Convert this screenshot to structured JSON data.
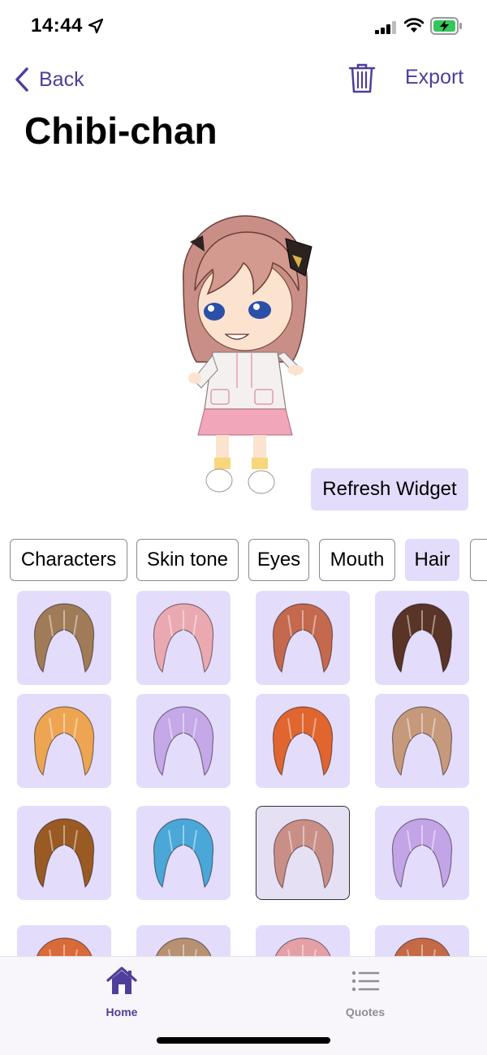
{
  "status_bar": {
    "time": "14:44",
    "icons": [
      "location-arrow-icon",
      "signal-icon",
      "wifi-icon",
      "battery-charging-icon"
    ]
  },
  "nav": {
    "back_label": "Back",
    "export_label": "Export",
    "trash_icon": "trash-icon"
  },
  "page": {
    "title": "Chibi-chan"
  },
  "preview": {
    "refresh_label": "Refresh Widget"
  },
  "tabs": [
    {
      "label": "Characters",
      "active": false
    },
    {
      "label": "Skin tone",
      "active": false
    },
    {
      "label": "Eyes",
      "active": false
    },
    {
      "label": "Mouth",
      "active": false
    },
    {
      "label": "Hair",
      "active": true
    }
  ],
  "hair_grid": {
    "selected_index": 10,
    "items": [
      {
        "name": "hair-1",
        "color": "#a07b58"
      },
      {
        "name": "hair-2",
        "color": "#eaa9b1"
      },
      {
        "name": "hair-3",
        "color": "#c4694d"
      },
      {
        "name": "hair-4",
        "color": "#5a3426"
      },
      {
        "name": "hair-5",
        "color": "#eda552"
      },
      {
        "name": "hair-6",
        "color": "#c4a8e8"
      },
      {
        "name": "hair-7",
        "color": "#e0652e"
      },
      {
        "name": "hair-8",
        "color": "#c6997a"
      },
      {
        "name": "hair-9",
        "color": "#9a5a24"
      },
      {
        "name": "hair-10",
        "color": "#4aa7d8"
      },
      {
        "name": "hair-11",
        "color": "#c98f86"
      },
      {
        "name": "hair-12",
        "color": "#c3a4e6"
      },
      {
        "name": "hair-13",
        "color": "#d96a3a"
      },
      {
        "name": "hair-14",
        "color": "#b89072"
      },
      {
        "name": "hair-15",
        "color": "#e4a0a6"
      },
      {
        "name": "hair-16",
        "color": "#c46a47"
      }
    ]
  },
  "tabbar": {
    "items": [
      {
        "label": "Home",
        "icon": "house-icon",
        "active": true
      },
      {
        "label": "Quotes",
        "icon": "list-icon",
        "active": false
      }
    ]
  },
  "colors": {
    "accent": "#4f3e9a",
    "tile_bg": "#e4dcfb",
    "inactive": "#8e8e93"
  }
}
